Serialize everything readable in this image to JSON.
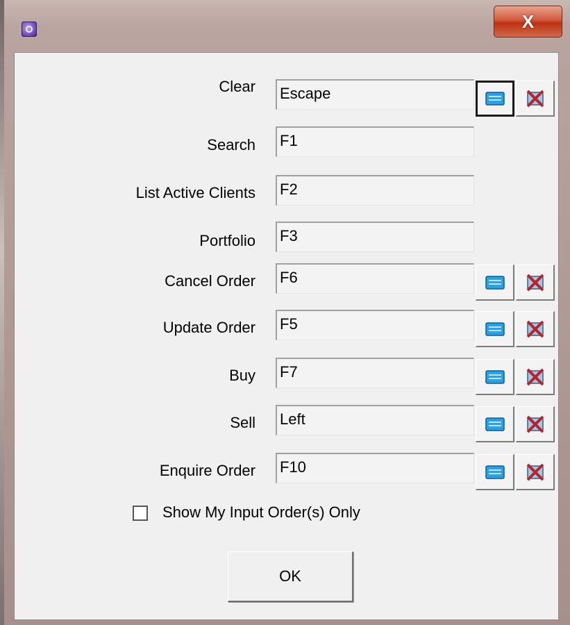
{
  "window": {
    "app_icon": "gear-icon",
    "close_label": "X"
  },
  "shortcuts": [
    {
      "label": "Clear",
      "value": "Escape",
      "has_buttons": true,
      "focused": true
    },
    {
      "label": "Search",
      "value": "F1",
      "has_buttons": false
    },
    {
      "label": "List Active Clients",
      "value": "F2",
      "has_buttons": false
    },
    {
      "label": "Portfolio",
      "value": "F3",
      "has_buttons": false
    },
    {
      "label": "Cancel Order",
      "value": "F6",
      "has_buttons": true
    },
    {
      "label": "Update Order",
      "value": "F5",
      "has_buttons": true
    },
    {
      "label": "Buy",
      "value": "F7",
      "has_buttons": true
    },
    {
      "label": "Sell",
      "value": "Left",
      "has_buttons": true
    },
    {
      "label": "Enquire Order",
      "value": "F10",
      "has_buttons": true
    }
  ],
  "row_buttons": {
    "assign_icon": "keyboard-icon",
    "remove_icon": "remove-key-icon"
  },
  "options": {
    "show_my_input_only_label": "Show My Input Order(s) Only",
    "show_my_input_only_checked": false
  },
  "footer": {
    "ok_label": "OK"
  },
  "colors": {
    "close_red": "#c7432a",
    "keyboard_blue": "#2aa0e8",
    "remove_red": "#c0202a"
  }
}
